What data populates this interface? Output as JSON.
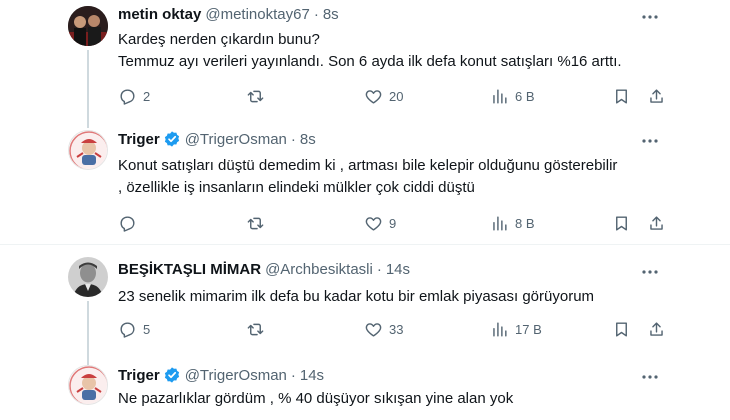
{
  "tweets": [
    {
      "name": "metin oktay",
      "handle": "@metinoktay67",
      "time": "8s",
      "lines": [
        "Kardeş nerden çıkardın bunu?",
        "Temmuz ayı verileri yayınlandı. Son 6 ayda ilk defa konut satışları %16 arttı."
      ],
      "replies": "2",
      "retweets": "",
      "likes": "20",
      "views": "6 B"
    },
    {
      "name": "Triger",
      "handle": "@TrigerOsman",
      "time": "8s",
      "lines": [
        "Konut satışları düştü demedim ki , artması bile kelepir olduğunu gösterebilir",
        ", özellikle iş insanların elindeki mülkler  çok ciddi düştü"
      ],
      "replies": "",
      "retweets": "",
      "likes": "9",
      "views": "8 B"
    },
    {
      "name": "BEŞİKTAŞLI MİMAR",
      "handle": "@Archbesiktasli",
      "time": "14s",
      "lines": [
        "23 senelik mimarim ilk defa bu kadar kotu bir emlak piyasası görüyorum"
      ],
      "replies": "5",
      "retweets": "",
      "likes": "33",
      "views": "17 B"
    },
    {
      "name": "Triger",
      "handle": "@TrigerOsman",
      "time": "14s",
      "lines": [
        "Ne pazarlıklar gördüm , % 40 düşüyor sıkışan yine alan yok"
      ]
    }
  ],
  "separator": "·",
  "colors": {
    "verified": "#1d9bf0",
    "muted": "#536471",
    "divider": "#eff3f4"
  },
  "icons": [
    "reply-icon",
    "retweet-icon",
    "like-icon",
    "views-icon",
    "bookmark-icon",
    "share-icon",
    "more-icon",
    "verified-icon"
  ]
}
